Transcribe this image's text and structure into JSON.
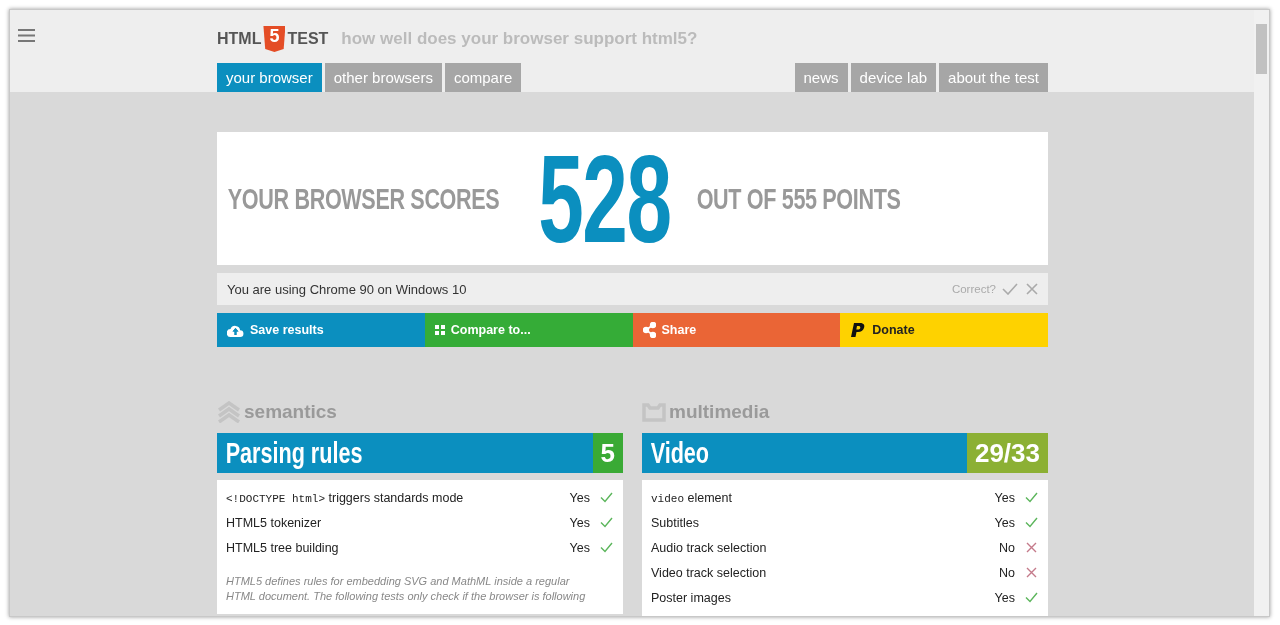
{
  "header": {
    "logo_left": "HTML",
    "logo_badge": "5",
    "logo_right": "TEST",
    "tagline": "how well does your browser support html5?"
  },
  "nav_left": [
    {
      "label": "your browser",
      "selected": true
    },
    {
      "label": "other browsers",
      "selected": false
    },
    {
      "label": "compare",
      "selected": false
    }
  ],
  "nav_right": [
    {
      "label": "news",
      "selected": false
    },
    {
      "label": "device lab",
      "selected": false
    },
    {
      "label": "about the test",
      "selected": false
    }
  ],
  "score": {
    "before": "YOUR BROWSER SCORES",
    "value": "528",
    "after": "OUT OF 555 POINTS"
  },
  "browser_line": {
    "text": "You are using Chrome 90 on Windows 10",
    "question": "Correct?"
  },
  "actions": [
    {
      "kind": "save",
      "label": "Save results",
      "color": "#0b8fbf"
    },
    {
      "kind": "compare",
      "label": "Compare to...",
      "color": "#35ac37"
    },
    {
      "kind": "share",
      "label": "Share",
      "color": "#ea6536"
    },
    {
      "kind": "donate",
      "label": "Donate",
      "color": "#fed200"
    }
  ],
  "sections": [
    {
      "kind": "semantics",
      "category": "semantics",
      "title": "Parsing rules",
      "score": "5",
      "color": "#3aaa35",
      "rows": [
        {
          "code": "<!DOCTYPE html>",
          "text": " triggers standards mode",
          "result": "Yes",
          "passed": true
        },
        {
          "code": "",
          "text": "HTML5 tokenizer",
          "result": "Yes",
          "passed": true
        },
        {
          "code": "",
          "text": "HTML5 tree building",
          "result": "Yes",
          "passed": true
        }
      ],
      "note": "HTML5 defines rules for embedding SVG and MathML inside a regular HTML document. The following tests only check if the browser is following"
    },
    {
      "kind": "multimedia",
      "category": "multimedia",
      "title": "Video",
      "score": "29/33",
      "color": "#8cb034",
      "rows": [
        {
          "code": "video",
          "text": " element",
          "result": "Yes",
          "passed": true
        },
        {
          "code": "",
          "text": "Subtitles",
          "result": "Yes",
          "passed": true
        },
        {
          "code": "",
          "text": "Audio track selection",
          "result": "No",
          "passed": false
        },
        {
          "code": "",
          "text": "Video track selection",
          "result": "No",
          "passed": false
        },
        {
          "code": "",
          "text": "Poster images",
          "result": "Yes",
          "passed": true
        }
      ]
    }
  ]
}
